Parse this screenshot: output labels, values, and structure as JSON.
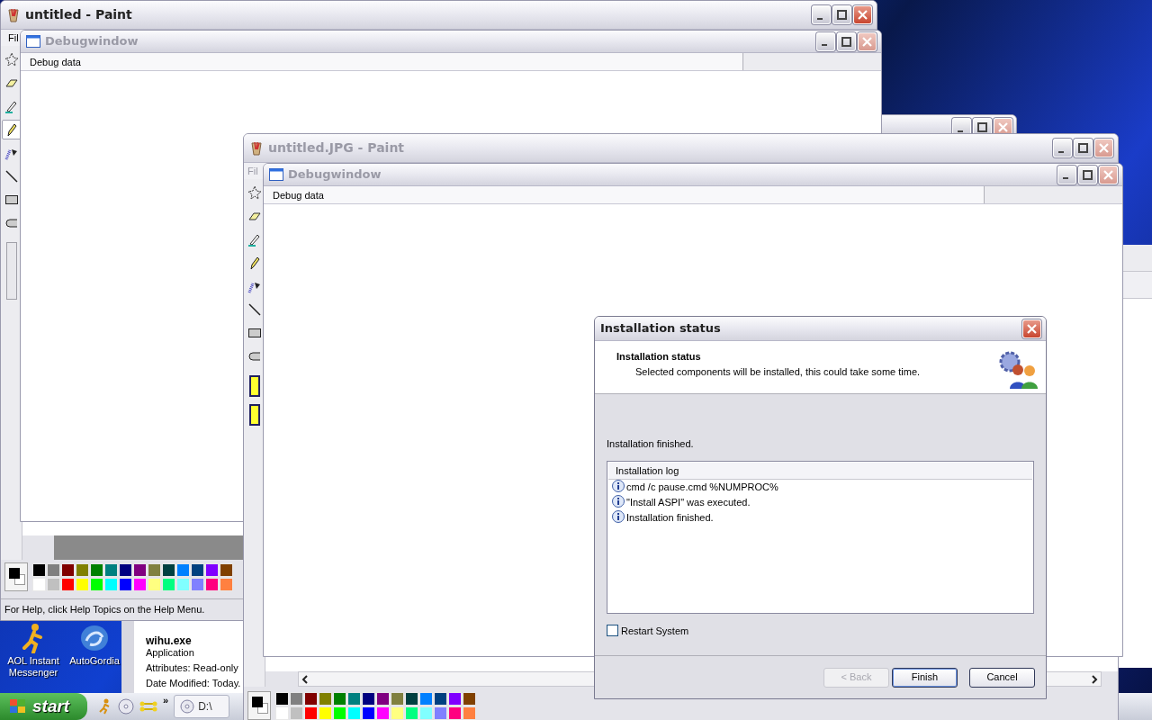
{
  "paint_window_back": {
    "title": "untitled - Paint",
    "active": true,
    "menu": [
      "Fil"
    ],
    "tools": [
      {
        "kind": "select",
        "selected": false
      },
      {
        "kind": "eraser",
        "selected": false
      },
      {
        "kind": "fill",
        "selected": false
      },
      {
        "kind": "pencil",
        "selected": true
      },
      {
        "kind": "airbrush",
        "selected": false
      },
      {
        "kind": "line",
        "selected": false
      },
      {
        "kind": "rectangle",
        "selected": false
      },
      {
        "kind": "ellipse",
        "selected": false
      }
    ],
    "palette": [
      {
        "color": "#000000"
      },
      {
        "color": "#808080"
      },
      {
        "color": "#800000"
      },
      {
        "color": "#808000"
      },
      {
        "color": "#008000"
      },
      {
        "color": "#008080"
      },
      {
        "color": "#000080"
      },
      {
        "color": "#800080"
      },
      {
        "color": "#808040"
      },
      {
        "color": "#004040"
      },
      {
        "color": "#0080ff"
      },
      {
        "color": "#004080"
      },
      {
        "color": "#8000ff"
      },
      {
        "color": "#804000"
      },
      {
        "color": "#ffffff"
      },
      {
        "color": "#c0c0c0"
      },
      {
        "color": "#ff0000"
      },
      {
        "color": "#ffff00"
      },
      {
        "color": "#00ff00"
      },
      {
        "color": "#00ffff"
      },
      {
        "color": "#0000ff"
      },
      {
        "color": "#ff00ff"
      },
      {
        "color": "#ffff80"
      },
      {
        "color": "#00ff80"
      },
      {
        "color": "#80ffff"
      },
      {
        "color": "#8080ff"
      },
      {
        "color": "#ff0080"
      },
      {
        "color": "#ff8040"
      }
    ],
    "status_bar": "For Help, click Help Topics on the Help Menu."
  },
  "debug_window_back": {
    "title": "Debugwindow",
    "active": false,
    "column": "Debug data"
  },
  "paint_window_front": {
    "title": "untitled.JPG - Paint",
    "active": false,
    "menu": [
      "Fil"
    ],
    "tools": [
      {
        "kind": "select",
        "selected": false
      },
      {
        "kind": "eraser",
        "selected": false
      },
      {
        "kind": "fill",
        "selected": false
      },
      {
        "kind": "pencil",
        "selected": false
      },
      {
        "kind": "airbrush",
        "selected": false
      },
      {
        "kind": "line",
        "selected": false
      },
      {
        "kind": "rectangle",
        "selected": false
      },
      {
        "kind": "ellipse",
        "selected": false
      }
    ],
    "palette": [
      {
        "color": "#000000"
      },
      {
        "color": "#808080"
      },
      {
        "color": "#800000"
      },
      {
        "color": "#808000"
      },
      {
        "color": "#008000"
      },
      {
        "color": "#008080"
      },
      {
        "color": "#000080"
      },
      {
        "color": "#800080"
      },
      {
        "color": "#808040"
      },
      {
        "color": "#004040"
      },
      {
        "color": "#0080ff"
      },
      {
        "color": "#004080"
      },
      {
        "color": "#8000ff"
      },
      {
        "color": "#804000"
      },
      {
        "color": "#ffffff"
      },
      {
        "color": "#c0c0c0"
      },
      {
        "color": "#ff0000"
      },
      {
        "color": "#ffff00"
      },
      {
        "color": "#00ff00"
      },
      {
        "color": "#00ffff"
      },
      {
        "color": "#0000ff"
      },
      {
        "color": "#ff00ff"
      },
      {
        "color": "#ffff80"
      },
      {
        "color": "#00ff80"
      },
      {
        "color": "#80ffff"
      },
      {
        "color": "#8080ff"
      },
      {
        "color": "#ff0080"
      },
      {
        "color": "#ff8040"
      }
    ]
  },
  "debug_window_front": {
    "title": "Debugwindow",
    "active": false,
    "column": "Debug data"
  },
  "dialog": {
    "title": "Installation status",
    "heading": "Installation status",
    "subheading": "Selected components will be installed, this could take some time.",
    "status": "Installation finished.",
    "log": {
      "column": "Installation log",
      "rows": [
        "cmd /c pause.cmd %NUMPROC%",
        "\"Install ASPI\" was executed.",
        "Installation finished."
      ]
    },
    "restart": {
      "label": "Restart System",
      "checked": false
    },
    "buttons": [
      {
        "label": "< Back",
        "disabled": true,
        "default": false
      },
      {
        "label": "Finish",
        "disabled": false,
        "default": true
      },
      {
        "label": "Cancel",
        "disabled": false,
        "default": false
      }
    ]
  },
  "desktop_icons": [
    {
      "kind": "aim",
      "label": "AOL Instant Messenger"
    },
    {
      "kind": "swirl",
      "label": "AutoGordia"
    }
  ],
  "file_info": {
    "name": "wihu.exe",
    "type": "Application",
    "lines": [
      "Attributes: Read-only",
      "Date Modified: Today."
    ]
  },
  "taskbar": {
    "start": "start",
    "overflow": "»",
    "tasks": [
      "D:\\"
    ]
  }
}
